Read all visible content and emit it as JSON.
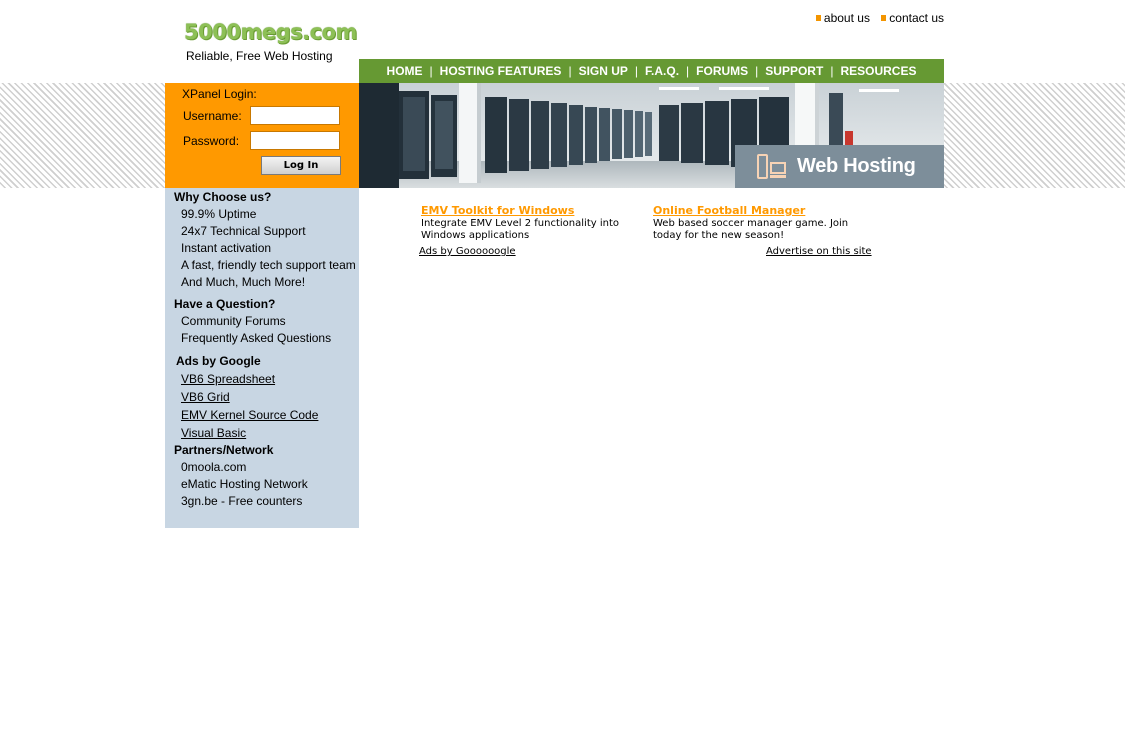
{
  "header": {
    "logo_text": "5000megs.com",
    "tagline": "Reliable, Free Web Hosting",
    "top_links": [
      "about us",
      "contact us"
    ]
  },
  "nav": {
    "items": [
      "HOME",
      "HOSTING FEATURES",
      "SIGN UP",
      "F.A.Q.",
      "FORUMS",
      "SUPPORT",
      "RESOURCES"
    ],
    "separator": "|"
  },
  "login": {
    "title": "XPanel Login:",
    "username_label": "Username:",
    "password_label": "Password:",
    "username_value": "",
    "password_value": "",
    "button_label": "Log In"
  },
  "banner": {
    "title": "Web Hosting"
  },
  "sidebar": {
    "why": {
      "heading": "Why Choose us?",
      "items": [
        "99.9% Uptime",
        "24x7 Technical Support",
        "Instant activation",
        "A fast, friendly tech support team",
        "And Much, Much More!"
      ]
    },
    "question": {
      "heading": "Have a Question?",
      "items": [
        "Community Forums",
        "Frequently Asked Questions"
      ]
    },
    "ads": {
      "heading": "Ads by Google",
      "items": [
        "VB6 Spreadsheet",
        "VB6 Grid",
        "EMV Kernel Source Code",
        "Visual Basic"
      ]
    },
    "partners": {
      "heading": "Partners/Network",
      "items": [
        "0moola.com",
        "eMatic Hosting Network",
        "3gn.be - Free counters"
      ]
    }
  },
  "ads": [
    {
      "title": "EMV Toolkit for Windows",
      "desc": "Integrate EMV Level 2 functionality into Windows applications"
    },
    {
      "title": "Online Football Manager",
      "desc": "Web based soccer manager game. Join today for the new season!"
    }
  ],
  "ad_footer": {
    "left": "Ads by Goooooogle",
    "right": "Advertise on this site"
  },
  "colors": {
    "nav_green": "#669933",
    "login_orange": "#ff9900",
    "sidebar_blue": "#c8d6e3",
    "ad_title_orange": "#ff9900"
  }
}
